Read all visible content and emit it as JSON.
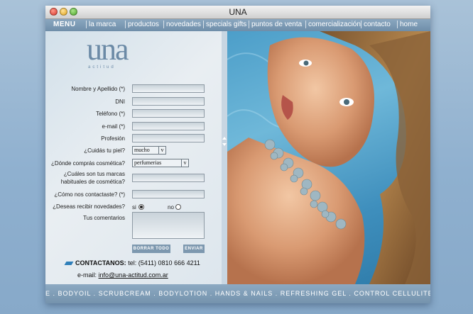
{
  "window": {
    "title": "UNA"
  },
  "nav": {
    "menu_label": "MENU",
    "items": [
      "la marca",
      "productos",
      "novedades",
      "specials gifts",
      "puntos de venta",
      "comercialización",
      "contacto",
      "home"
    ]
  },
  "logo": {
    "main": "una",
    "sub": "actitud"
  },
  "form": {
    "labels": {
      "nombre": "Nombre y Apellido (*)",
      "dni": "DNI",
      "telefono": "Teléfono (*)",
      "email": "e-mail (*)",
      "profesion": "Profesión",
      "piel": "¿Cuidás tu piel?",
      "compras": "¿Dónde comprás cosmética?",
      "marcas_1": "¿Cuáles son tus marcas",
      "marcas_2": "habituales de cosmética?",
      "contactaste": "¿Cómo nos contactaste? (*)",
      "novedades": "¿Deseas recibir novedades?",
      "comentarios": "Tus comentarios"
    },
    "piel_value": "mucho",
    "compras_value": "perfumerias",
    "select_arrow": "v",
    "novedades_options": {
      "si": "si",
      "no": "no",
      "selected": "si"
    },
    "buttons": {
      "borrar": "BORRAR TODO",
      "enviar": "ENVIAR"
    }
  },
  "contact": {
    "title": "CONTACTANOS:",
    "tel": "tel: (5411) 0810 666 4211",
    "email_label": "e-mail:",
    "email": "info@una-actitud.com.ar"
  },
  "ticker": {
    "text": "E . BODYOIL . SCRUBCREAM . BODYLOTION . HANDS & NAILS . REFRESHING GEL . CONTROL CELLULITE . SKINCARE . FRAGANCE"
  },
  "colors": {
    "accent": "#6f8ea9",
    "logo": "#6b8aa6",
    "phone_icon": "#2f7fb9"
  }
}
